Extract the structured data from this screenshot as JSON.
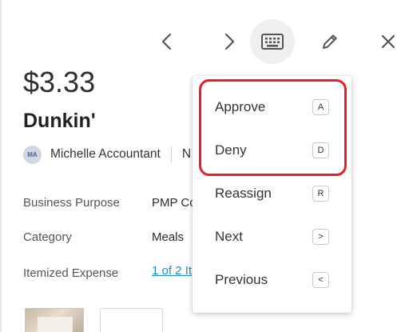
{
  "expense": {
    "amount": "$3.33",
    "merchant": "Dunkin'"
  },
  "user": {
    "initials": "MA",
    "name": "Michelle Accountant",
    "next_partial": "N"
  },
  "details": [
    {
      "label": "Business Purpose",
      "value": "PMP Co"
    },
    {
      "label": "Category",
      "value": "Meals"
    },
    {
      "label": "Itemized Expense",
      "value": "1 of 2 It"
    }
  ],
  "toolbar": {
    "icons": [
      "chevron-left-icon",
      "chevron-right-icon",
      "keyboard-icon",
      "pencil-icon",
      "close-icon"
    ]
  },
  "shortcut_menu": {
    "items": [
      {
        "label": "Approve",
        "key": "A"
      },
      {
        "label": "Deny",
        "key": "D"
      },
      {
        "label": "Reassign",
        "key": "R"
      },
      {
        "label": "Next",
        "key": ">"
      },
      {
        "label": "Previous",
        "key": "<"
      }
    ]
  },
  "colors": {
    "highlight": "#e32027",
    "link": "#1a8bd1",
    "active_button_bg": "#efefef"
  }
}
